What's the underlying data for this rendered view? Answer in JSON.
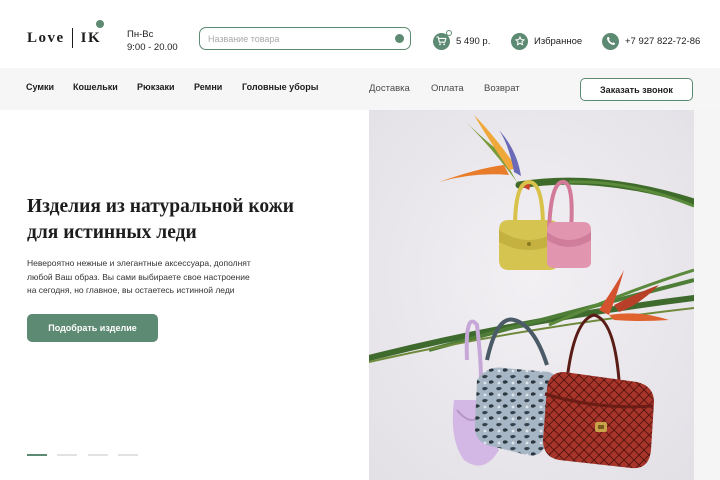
{
  "header": {
    "logo_left": "Love",
    "logo_right": "IK",
    "hours_days": "Пн-Вс",
    "hours_time": "9:00 - 20.00",
    "search_placeholder": "Название товара",
    "cart_total": "5 490 р.",
    "favorites_label": "Избранное",
    "phone": "+7 927 822-72-86"
  },
  "nav": {
    "categories": [
      {
        "label": "Сумки"
      },
      {
        "label": "Кошельки"
      },
      {
        "label": "Рюкзаки"
      },
      {
        "label": "Ремни"
      },
      {
        "label": "Головные уборы"
      }
    ],
    "info_links": [
      {
        "label": "Доставка"
      },
      {
        "label": "Оплата"
      },
      {
        "label": "Возврат"
      }
    ],
    "call_button": "Заказать звонок"
  },
  "hero": {
    "title_line1": "Изделия из натуральной кожи",
    "title_line2": "для истинных леди",
    "text_line1": "Невероятно нежные и элегантные аксессуара, дополнят",
    "text_line2": "любой Ваш образ. Вы сами выбираете свое настроение",
    "text_line3": "на сегодня, но главное, вы остаетесь истинной леди",
    "button": "Подобрать изделие",
    "slides_total": 4,
    "active_slide": 1
  },
  "icons": {
    "cart": "cart-icon",
    "favorites": "star-icon",
    "phone": "phone-icon",
    "search": "search-icon"
  },
  "colors": {
    "accent": "#5d8a72",
    "nav_background": "#f5f6f5",
    "text": "#1d1d1d",
    "photo_background": "#eceaee"
  }
}
